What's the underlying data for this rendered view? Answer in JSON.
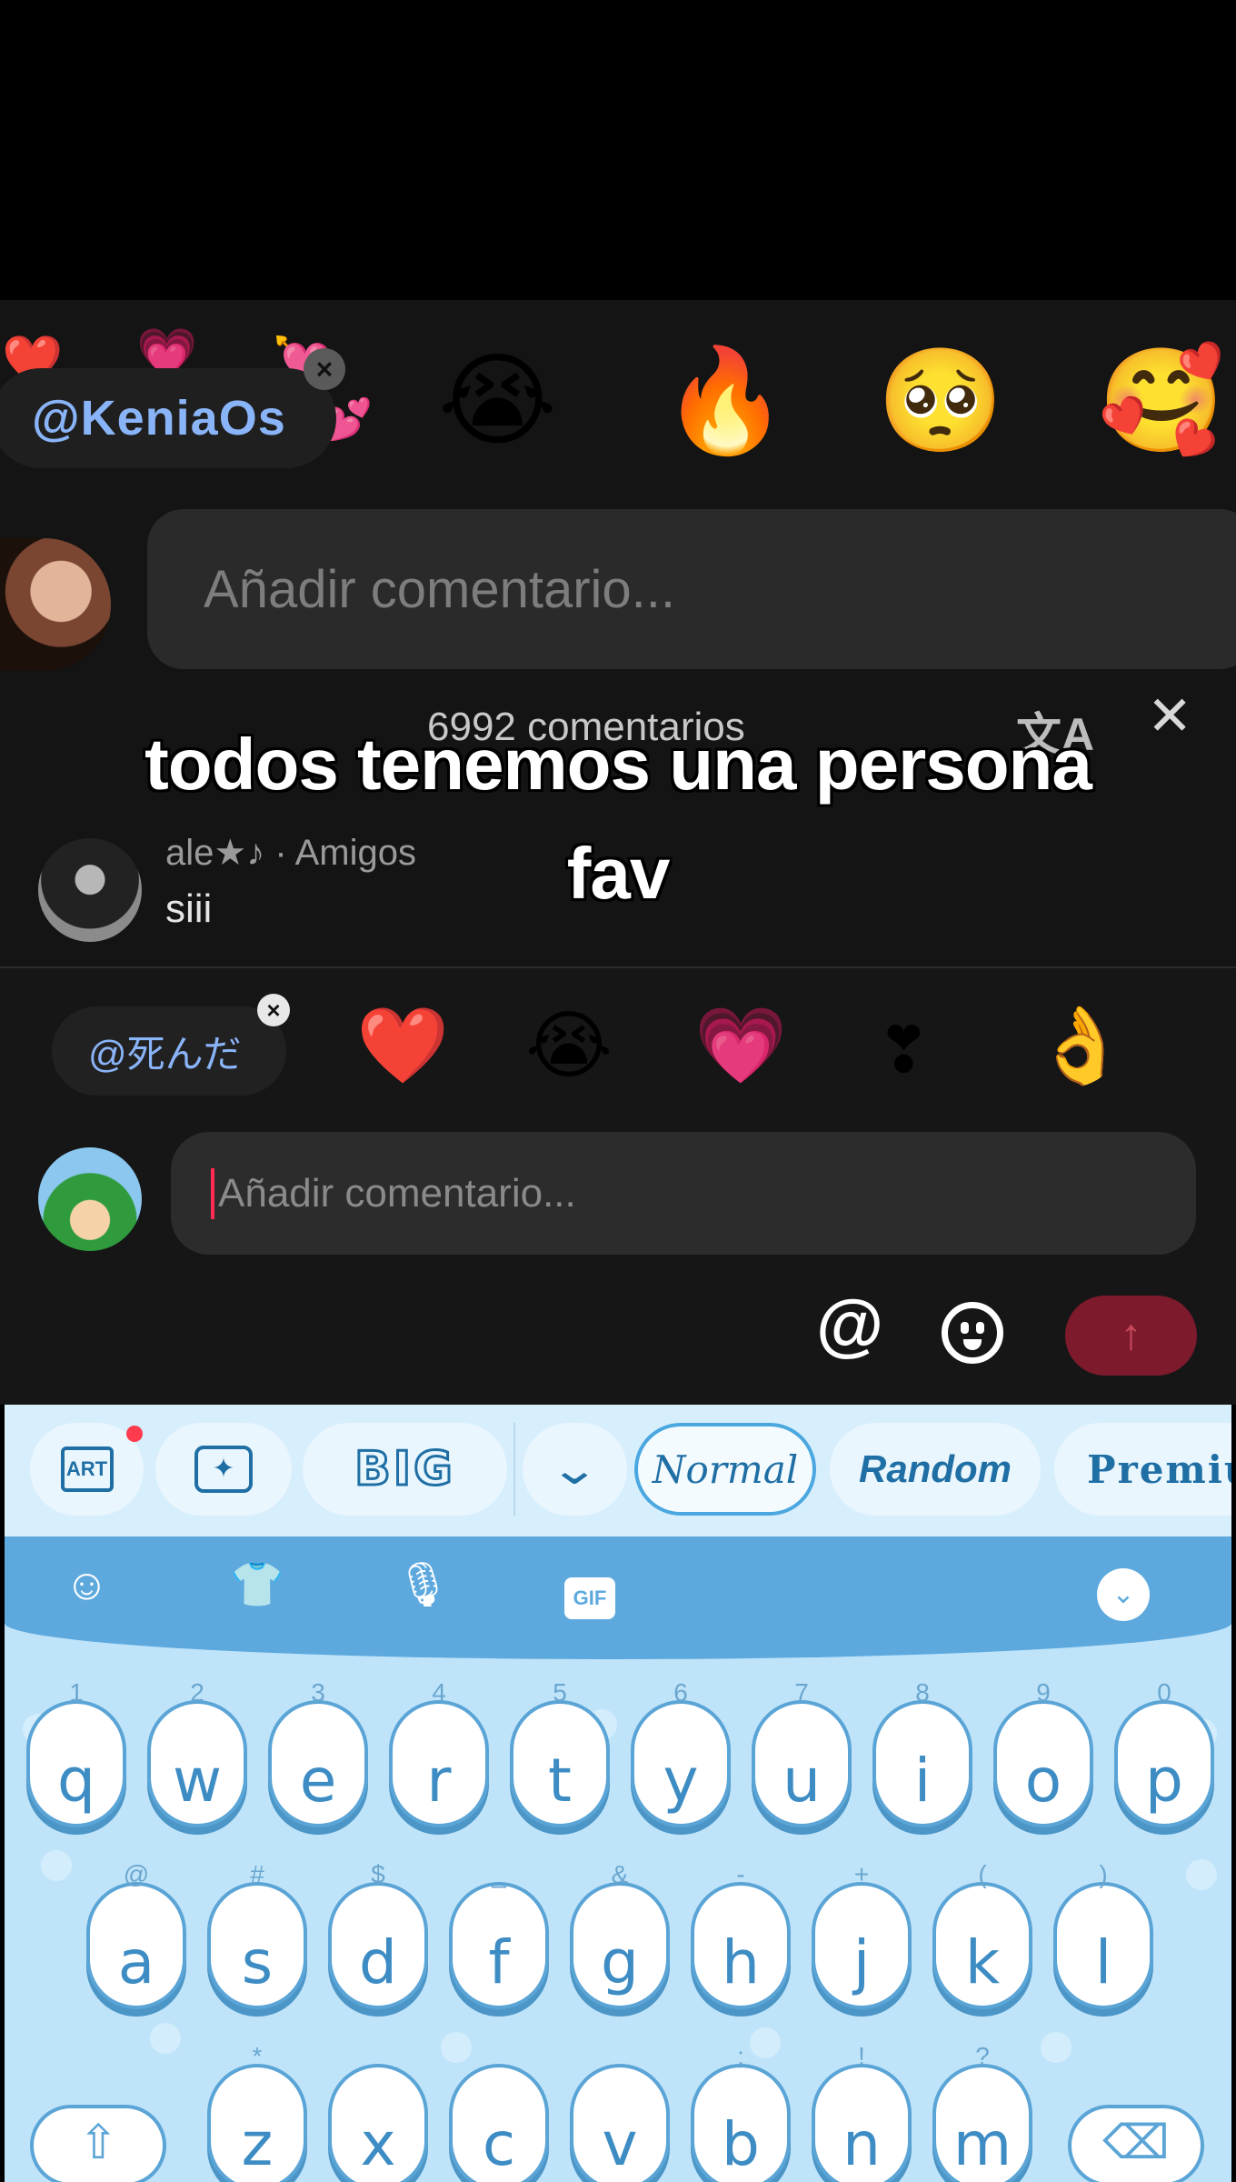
{
  "top_frame": {
    "mention_chip": "@KeniaOs",
    "reactions": [
      "😭",
      "🔥",
      "🥺",
      "🥰"
    ],
    "comment_placeholder": "Añadir comentario...",
    "comments_count": "6992 comentarios",
    "translate_icon": "文A",
    "close": "✕"
  },
  "caption": {
    "line1": "todos tenemos una persona",
    "line2": "fav"
  },
  "comment": {
    "user": "ale★♪ · Amigos",
    "text": "siii"
  },
  "compose": {
    "mention_chip": "@死んだ",
    "reactions": [
      "❤️",
      "😭",
      "💗",
      "❣",
      "👌"
    ],
    "placeholder": "Añadir comentario...",
    "at_symbol": "@",
    "send_arrow": "↑"
  },
  "keyboard": {
    "toolbar": {
      "art": "ART",
      "big": "BIG",
      "chevron": "⌄",
      "styles": [
        "Normal",
        "Random",
        "Premiu"
      ]
    },
    "quick": {
      "gif": "GIF",
      "collapse": "⌄"
    },
    "row1": [
      "q",
      "w",
      "e",
      "r",
      "t",
      "y",
      "u",
      "i",
      "o",
      "p"
    ],
    "row1_sub": [
      "1",
      "2",
      "3",
      "4",
      "5",
      "6",
      "7",
      "8",
      "9",
      "0"
    ],
    "row2": [
      "a",
      "s",
      "d",
      "f",
      "g",
      "h",
      "j",
      "k",
      "l"
    ],
    "row2_sub": [
      "@",
      "#",
      "$",
      "_",
      "&",
      "-",
      "+",
      "(",
      ")"
    ],
    "row3": [
      "z",
      "x",
      "c",
      "v",
      "b",
      "n",
      "m"
    ],
    "row3_sub": [
      "*",
      "",
      "",
      "",
      ";",
      "!",
      "?"
    ]
  },
  "colors": {
    "mention": "#8ab4f8",
    "send_button": "#7d1a2c",
    "keyboard_bg": "#bfe4fa",
    "key_accent": "#3d8cc4"
  }
}
